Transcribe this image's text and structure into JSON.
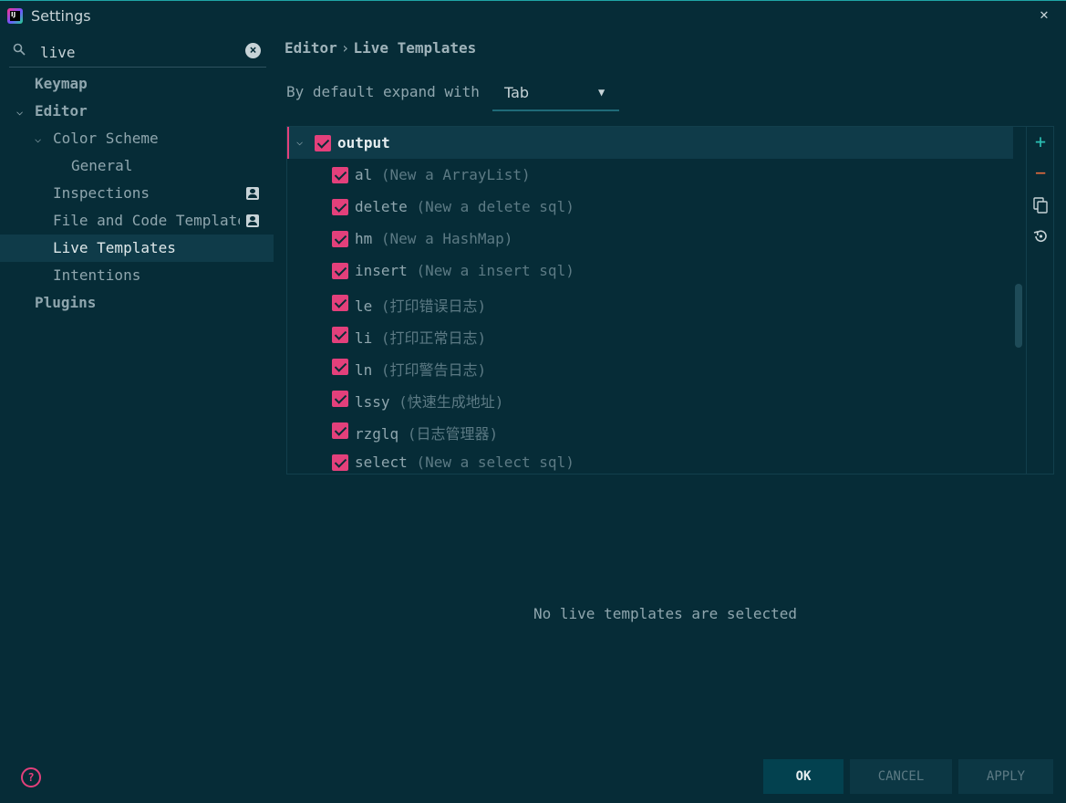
{
  "window": {
    "title": "Settings",
    "app_icon_letter": "IJ"
  },
  "search": {
    "value": "live"
  },
  "sidebar": {
    "items": [
      {
        "label": "Keymap"
      },
      {
        "label": "Editor"
      },
      {
        "label": "Color Scheme"
      },
      {
        "label": "General"
      },
      {
        "label": "Inspections"
      },
      {
        "label": "File and Code Templates"
      },
      {
        "label": "Live Templates"
      },
      {
        "label": "Intentions"
      },
      {
        "label": "Plugins"
      }
    ]
  },
  "breadcrumb": {
    "parent": "Editor",
    "separator": "›",
    "current": "Live Templates"
  },
  "expand": {
    "label": "By default expand with",
    "value": "Tab"
  },
  "group": {
    "name": "output",
    "checked": true
  },
  "templates": [
    {
      "abbr": "al",
      "desc": "(New a ArrayList)"
    },
    {
      "abbr": "delete",
      "desc": "(New a delete sql)"
    },
    {
      "abbr": "hm",
      "desc": "(New a HashMap)"
    },
    {
      "abbr": "insert",
      "desc": "(New a insert sql)"
    },
    {
      "abbr": "le",
      "desc": "(打印错误日志)"
    },
    {
      "abbr": "li",
      "desc": "(打印正常日志)"
    },
    {
      "abbr": "ln",
      "desc": "(打印警告日志)"
    },
    {
      "abbr": "lssy",
      "desc": "(快速生成地址)"
    },
    {
      "abbr": "rzglq",
      "desc": "(日志管理器)"
    },
    {
      "abbr": "select",
      "desc": "(New a select sql)"
    }
  ],
  "empty_message": "No live templates are selected",
  "buttons": {
    "ok": "OK",
    "cancel": "CANCEL",
    "apply": "APPLY"
  },
  "colors": {
    "background": "#062c37",
    "accent": "#e3407b",
    "selection": "#0f3b49",
    "add": "#2bc0b4",
    "remove": "#e06a3d"
  },
  "icons": {
    "search": "search-icon",
    "clear": "clear-icon",
    "help": "help-icon",
    "add": "add-icon",
    "remove": "remove-icon",
    "copy": "copy-icon",
    "revert": "revert-icon",
    "close": "close-icon"
  }
}
